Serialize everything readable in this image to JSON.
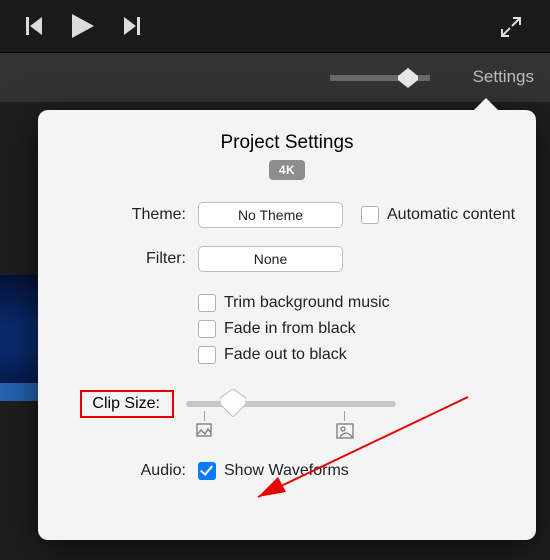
{
  "secbar": {
    "settings": "Settings"
  },
  "popover": {
    "title": "Project Settings",
    "badge": "4K",
    "theme": {
      "label": "Theme:",
      "value": "No Theme"
    },
    "auto_content": "Automatic content",
    "filter": {
      "label": "Filter:",
      "value": "None"
    },
    "options": {
      "trim": "Trim background music",
      "fadein": "Fade in from black",
      "fadeout": "Fade out to black"
    },
    "clip_size_label": "Clip Size:",
    "audio": {
      "label": "Audio:",
      "show_waveforms": "Show Waveforms"
    }
  }
}
